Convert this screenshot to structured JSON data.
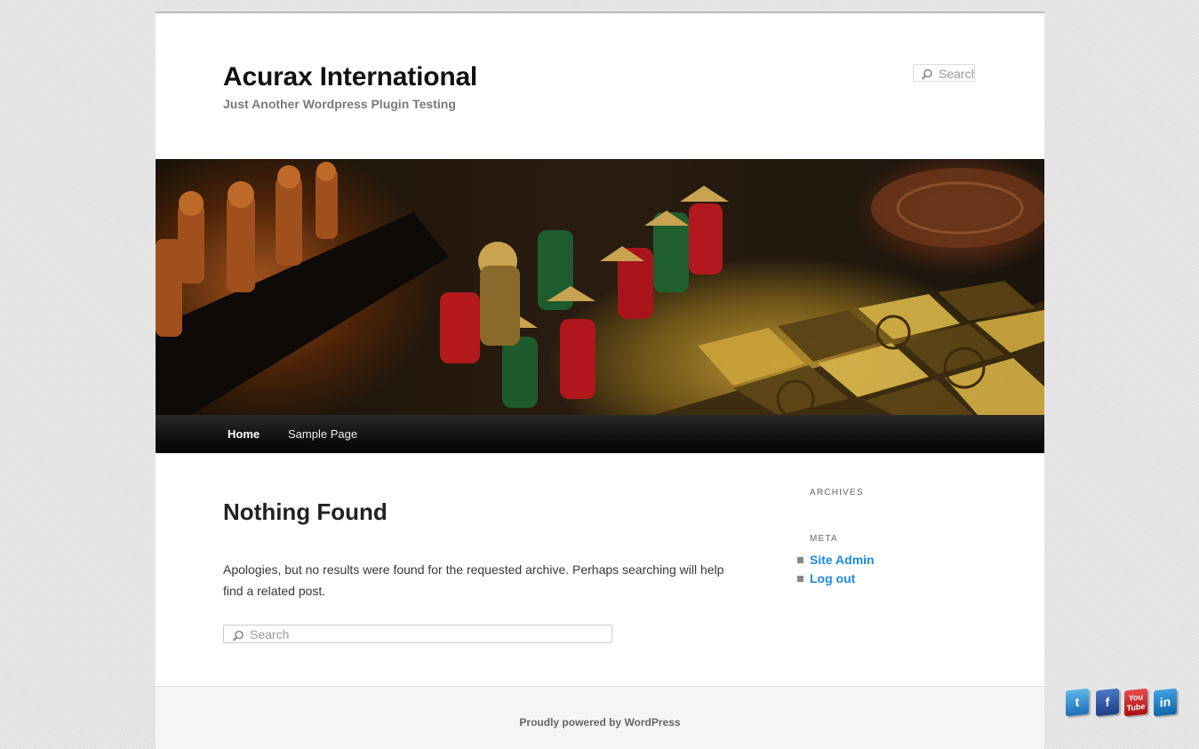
{
  "site": {
    "title": "Acurax International",
    "description": "Just Another Wordpress Plugin Testing"
  },
  "header_search": {
    "placeholder": "Search"
  },
  "nav": {
    "items": [
      {
        "label": "Home"
      },
      {
        "label": "Sample Page"
      }
    ]
  },
  "content": {
    "title": "Nothing Found",
    "text": "Apologies, but no results were found for the requested archive. Perhaps searching will help find a related post.",
    "search_placeholder": "Search"
  },
  "sidebar": {
    "archives_title": "ARCHIVES",
    "meta_title": "META",
    "meta_links": [
      {
        "label": "Site Admin"
      },
      {
        "label": "Log out"
      }
    ]
  },
  "footer": {
    "text": "Proudly powered by WordPress"
  },
  "social": {
    "items": [
      {
        "icon": "twitter-icon",
        "glyph": "t"
      },
      {
        "icon": "facebook-icon",
        "glyph": "f"
      },
      {
        "icon": "youtube-icon",
        "glyph": "You Tube"
      },
      {
        "icon": "linkedin-icon",
        "glyph": "in"
      }
    ]
  },
  "colors": {
    "link": "#1b8be0",
    "nav_bg": "#111111",
    "page_bg": "#e2e2e2"
  }
}
